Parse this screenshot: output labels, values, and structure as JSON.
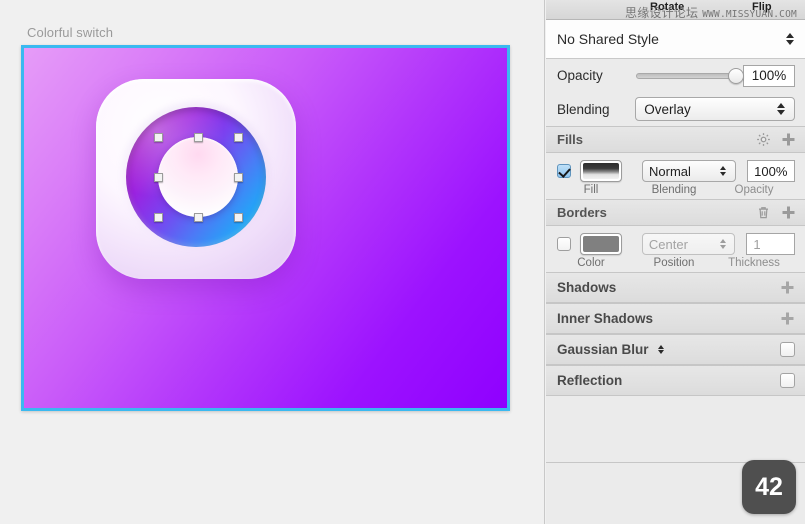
{
  "toolbar": {
    "rotate_label": "Rotate",
    "flip_label": "Flip"
  },
  "watermark": {
    "cn": "思缘设计论坛",
    "url": "WWW.MISSYUAN.COM"
  },
  "canvas": {
    "artboard_name": "Colorful switch",
    "selection_color": "#3ab9f0",
    "background": "#f0f0f0",
    "artboard_gradient_start": "#e69cf8",
    "artboard_gradient_end": "#8f00ff",
    "icon": {
      "outer_shape": "rounded-square-white",
      "inner_ring_gradient_start": "#9a04b0",
      "inner_ring_gradient_end": "#18c6fb",
      "knob_color": "#ffe9f7"
    }
  },
  "inspector": {
    "shared_style": {
      "value": "No Shared Style"
    },
    "opacity": {
      "label": "Opacity",
      "value": "100%",
      "slider_percent": 100
    },
    "blending": {
      "label": "Blending",
      "value": "Overlay"
    },
    "fills": {
      "title": "Fills",
      "enabled": true,
      "blending_value": "Normal",
      "opacity_value": "100%",
      "caption_fill": "Fill",
      "caption_blending": "Blending",
      "caption_opacity": "Opacity"
    },
    "borders": {
      "title": "Borders",
      "enabled": false,
      "position_value": "Center",
      "thickness_value": "1",
      "caption_color": "Color",
      "caption_position": "Position",
      "caption_thickness": "Thickness"
    },
    "shadows": {
      "title": "Shadows"
    },
    "inner_shadows": {
      "title": "Inner Shadows"
    },
    "gaussian_blur": {
      "title": "Gaussian Blur",
      "enabled": false
    },
    "reflection": {
      "title": "Reflection",
      "enabled": false
    },
    "badge": {
      "value": "42"
    }
  }
}
